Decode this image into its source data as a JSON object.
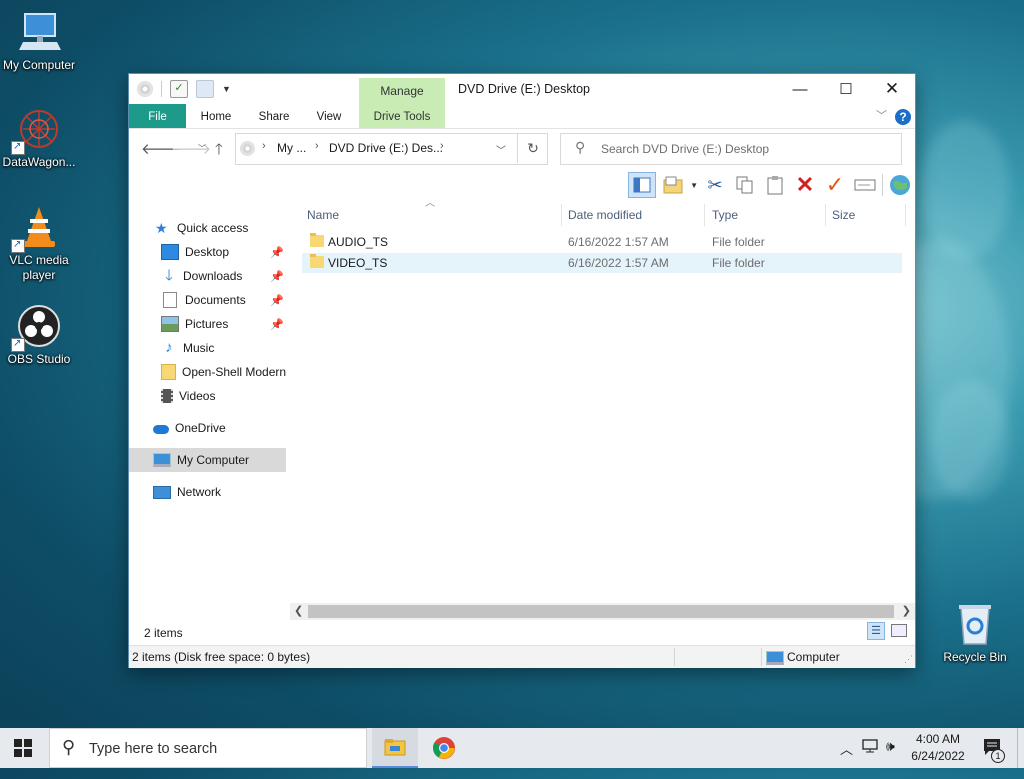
{
  "desktop": {
    "icons": [
      {
        "label": "My Computer"
      },
      {
        "label": "DataWagon..."
      },
      {
        "label": "VLC media player"
      },
      {
        "label": "OBS Studio"
      },
      {
        "label": "Recycle Bin"
      }
    ]
  },
  "window": {
    "title": "DVD Drive (E:) Desktop",
    "manage_tab": "Manage",
    "ribbon_tabs": [
      "File",
      "Home",
      "Share",
      "View",
      "Drive Tools"
    ],
    "address": {
      "crumbs": [
        "My ...",
        "DVD Drive (E:) Des..."
      ]
    },
    "search_placeholder": "Search DVD Drive (E:) Desktop",
    "nav": {
      "quick_access": "Quick access",
      "items": [
        {
          "label": "Desktop",
          "pinned": true,
          "icon": "desktop-icon"
        },
        {
          "label": "Downloads",
          "pinned": true,
          "icon": "download-arrow-icon"
        },
        {
          "label": "Documents",
          "pinned": true,
          "icon": "document-icon"
        },
        {
          "label": "Pictures",
          "pinned": true,
          "icon": "picture-icon"
        },
        {
          "label": "Music",
          "pinned": false,
          "icon": "music-note-icon"
        },
        {
          "label": "Open-Shell Modern",
          "pinned": false,
          "icon": "folder-icon"
        },
        {
          "label": "Videos",
          "pinned": false,
          "icon": "film-icon"
        }
      ],
      "onedrive": "OneDrive",
      "my_computer": "My Computer",
      "network": "Network"
    },
    "columns": {
      "name": "Name",
      "date": "Date modified",
      "type": "Type",
      "size": "Size"
    },
    "files": [
      {
        "name": "AUDIO_TS",
        "date": "6/16/2022 1:57 AM",
        "type": "File folder"
      },
      {
        "name": "VIDEO_TS",
        "date": "6/16/2022 1:57 AM",
        "type": "File folder"
      }
    ],
    "item_count": "2 items",
    "status_left": "2 items (Disk free space: 0 bytes)",
    "status_right": "Computer"
  },
  "taskbar": {
    "search_placeholder": "Type here to search",
    "time": "4:00 AM",
    "date": "6/24/2022",
    "notification_count": "1"
  },
  "colors": {
    "accent": "#1e9a8a",
    "manage": "#c8ecb4",
    "selection": "#e5f3fb",
    "taskbar": "#e6e9ed"
  }
}
